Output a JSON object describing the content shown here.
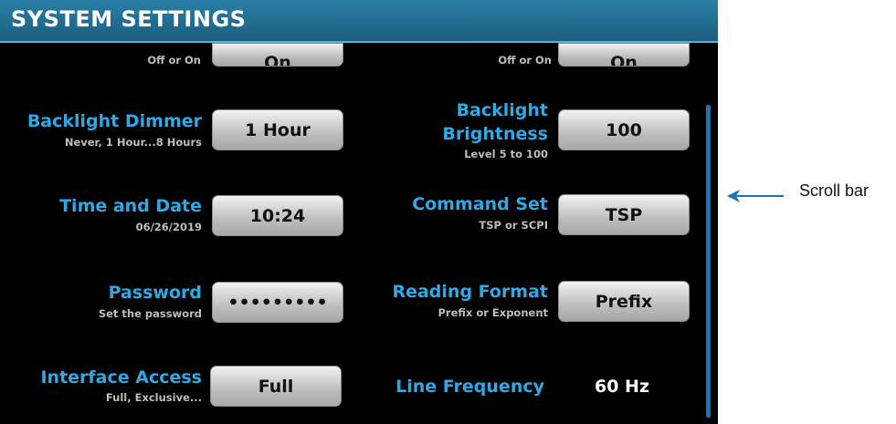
{
  "header": {
    "title": "SYSTEM SETTINGS"
  },
  "rows": {
    "top_left": {
      "subtitle": "Off or On",
      "button": "On"
    },
    "top_right": {
      "subtitle": "Off or On",
      "button": "On"
    },
    "backlight_dimmer": {
      "label": "Backlight Dimmer",
      "subtitle": "Never, 1 Hour...8 Hours",
      "button": "1 Hour"
    },
    "backlight_brightness": {
      "label_line1": "Backlight",
      "label_line2": "Brightness",
      "subtitle": "Level 5 to 100",
      "button": "100"
    },
    "time_and_date": {
      "label": "Time and Date",
      "subtitle": "06/26/2019",
      "button": "10:24"
    },
    "command_set": {
      "label": "Command Set",
      "subtitle": "TSP or SCPI",
      "button": "TSP"
    },
    "password": {
      "label": "Password",
      "subtitle": "Set the password",
      "button": "•••••••••"
    },
    "reading_format": {
      "label": "Reading Format",
      "subtitle": "Prefix or Exponent",
      "button": "Prefix"
    },
    "interface_access": {
      "label": "Interface Access",
      "subtitle": "Full, Exclusive...",
      "button": "Full"
    },
    "line_frequency": {
      "label": "Line Frequency",
      "value": "60 Hz"
    }
  },
  "annotation": {
    "text": "Scroll bar"
  },
  "colors": {
    "label_blue": "#2fa9e6",
    "title_bar": "#1b5e80",
    "scrollbar": "#1b76b5"
  }
}
